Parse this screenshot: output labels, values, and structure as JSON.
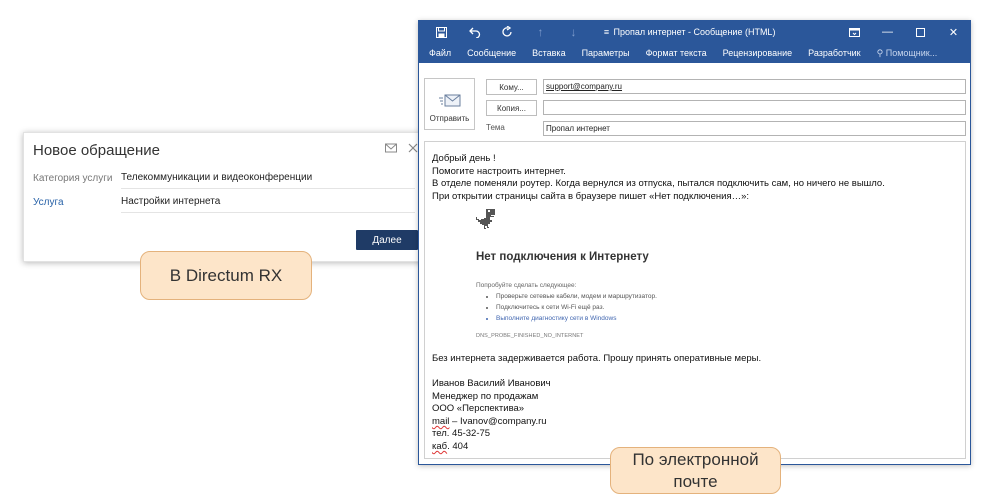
{
  "rx": {
    "title": "Новое обращение",
    "icons": [
      "mail-icon",
      "close-icon"
    ],
    "fields": [
      {
        "label": "Категория услуги",
        "value": "Телекоммуникации и видеоконференции"
      },
      {
        "label": "Услуга",
        "value": "Настройки интернета"
      }
    ],
    "next_button": "Далее"
  },
  "callouts": {
    "rx": "В Directum RX",
    "mail_line1": "По электронной",
    "mail_line2": "почте"
  },
  "outlook": {
    "window_title": "Пропал интернет - Сообщение (HTML)",
    "qat_icons": [
      "save-icon",
      "undo-icon",
      "redo-icon",
      "up-arrow-icon",
      "down-arrow-icon",
      "customize-icon"
    ],
    "window_buttons": [
      "ribbon-display-icon",
      "minimize-icon",
      "maximize-icon",
      "close-icon"
    ],
    "ribbon_tabs": [
      "Файл",
      "Сообщение",
      "Вставка",
      "Параметры",
      "Формат текста",
      "Рецензирование",
      "Разработчик"
    ],
    "help_tab": "Помощник...",
    "send_button": "Отправить",
    "to_button": "Кому...",
    "cc_button": "Копия...",
    "subject_label": "Тема",
    "to_value": "support@company.ru",
    "cc_value": "",
    "subject_value": "Пропал интернет",
    "body": {
      "greeting": "Добрый день !",
      "l1": "Помогите настроить интернет.",
      "l2": "В отделе поменяли роутер. Когда вернулся из отпуска, пытался подключить сам, но ничего не вышло.",
      "l3": "При открытии страницы сайта в браузере пишет «Нет подключения…»:",
      "error": {
        "title": "Нет подключения к Интернету",
        "try_label": "Попробуйте сделать следующее:",
        "items": [
          "Проверьте сетевые кабели, модем и маршрутизатор.",
          "Подключитесь к сети Wi-Fi ещё раз.",
          "Выполните диагностику сети в Windows"
        ],
        "code": "DNS_PROBE_FINISHED_NO_INTERNET"
      },
      "l4": "Без интернета задерживается работа. Прошу принять оперативные меры.",
      "sig_name": "Иванов Василий Иванович",
      "sig_role": "Менеджер по продажам",
      "sig_company": "ООО «Перспектива»",
      "sig_mail_word": "mail",
      "sig_mail_rest": " – Ivanov@company.ru",
      "sig_phone": "тел. 45-32-75",
      "sig_office_word": "каб",
      "sig_office_rest": ". 404"
    }
  },
  "colors": {
    "outlook_blue": "#2b579a",
    "rx_button": "#1f3b66",
    "callout_fill": "#fde5c9",
    "callout_border": "#e4b27c",
    "link": "#2a63a8"
  }
}
